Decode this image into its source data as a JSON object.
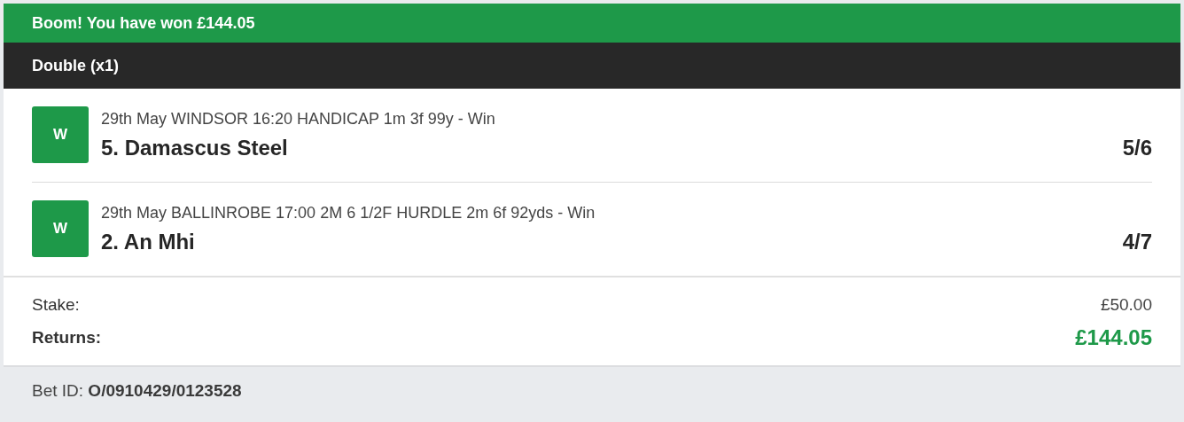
{
  "banner": {
    "text": "Boom! You have won £144.05",
    "won": true
  },
  "bet_type": "Double (x1)",
  "selections": [
    {
      "result": "W",
      "won": true,
      "event": "29th May WINDSOR 16:20 HANDICAP 1m 3f 99y - Win",
      "runner": "5. Damascus Steel",
      "odds": "5/6"
    },
    {
      "result": "W",
      "won": true,
      "event": "29th May BALLINROBE 17:00 2M 6 1/2F HURDLE 2m 6f 92yds - Win",
      "runner": "2. An Mhi",
      "odds": "4/7"
    }
  ],
  "summary": [
    {
      "kind": "plain",
      "label": "Stake:",
      "value": "£50.00"
    },
    {
      "kind": "total",
      "label": "Returns:",
      "value": "£144.05"
    }
  ],
  "bet_id": "Bet ID: **O/0910429/0123528**"
}
